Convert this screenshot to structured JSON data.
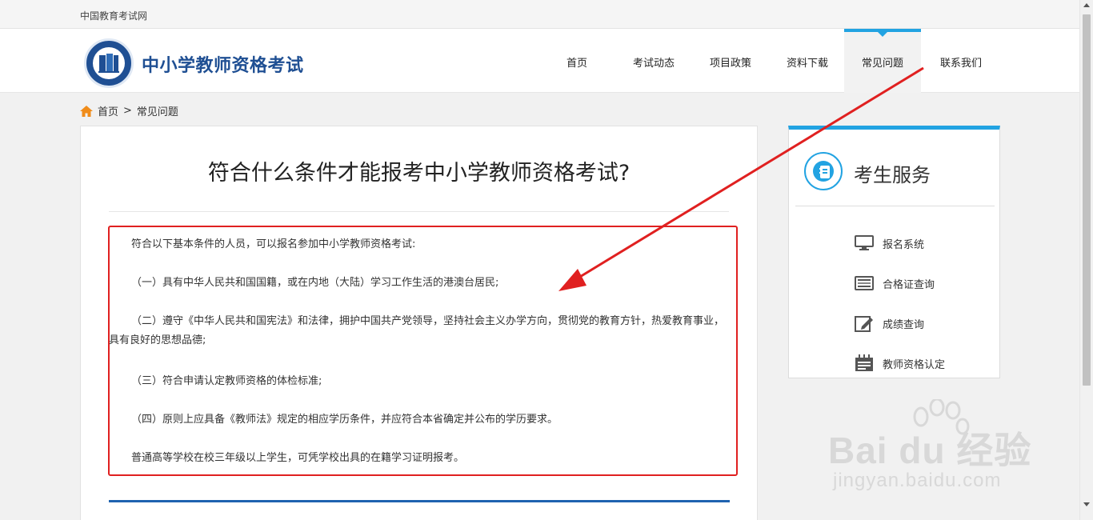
{
  "topbar": {
    "site_name": "中国教育考试网"
  },
  "header": {
    "logo_title": "中小学教师资格考试",
    "nav": [
      {
        "label": "首页",
        "active": false
      },
      {
        "label": "考试动态",
        "active": false
      },
      {
        "label": "项目政策",
        "active": false
      },
      {
        "label": "资料下载",
        "active": false
      },
      {
        "label": "常见问题",
        "active": true
      },
      {
        "label": "联系我们",
        "active": false
      }
    ]
  },
  "breadcrumb": {
    "home": "首页",
    "separator": ">",
    "current": "常见问题"
  },
  "article": {
    "title": "符合什么条件才能报考中小学教师资格考试?",
    "paragraphs": [
      "符合以下基本条件的人员，可以报名参加中小学教师资格考试:",
      "（一）具有中华人民共和国国籍，或在内地（大陆）学习工作生活的港澳台居民;",
      "（二）遵守《中华人民共和国宪法》和法律，拥护中国共产党领导，坚持社会主义办学方向，贯彻党的教育方针，热爱教育事业，具有良好的思想品德;",
      "（三）符合申请认定教师资格的体检标准;",
      "（四）原则上应具备《教师法》规定的相应学历条件，并应符合本省确定并公布的学历要求。",
      "普通高等学校在校三年级以上学生，可凭学校出具的在籍学习证明报考。"
    ]
  },
  "sidebar": {
    "title": "考生服务",
    "links": [
      {
        "label": "报名系统",
        "icon": "monitor-icon"
      },
      {
        "label": "合格证查询",
        "icon": "keyboard-icon"
      },
      {
        "label": "成绩查询",
        "icon": "edit-icon"
      },
      {
        "label": "教师资格认定",
        "icon": "calendar-icon"
      }
    ]
  },
  "watermark": {
    "brand": "Bai du 经验",
    "url": "jingyan.baidu.com"
  },
  "colors": {
    "brand_blue": "#1f4f93",
    "accent": "#22a3e2",
    "annotation_red": "#e02020"
  }
}
